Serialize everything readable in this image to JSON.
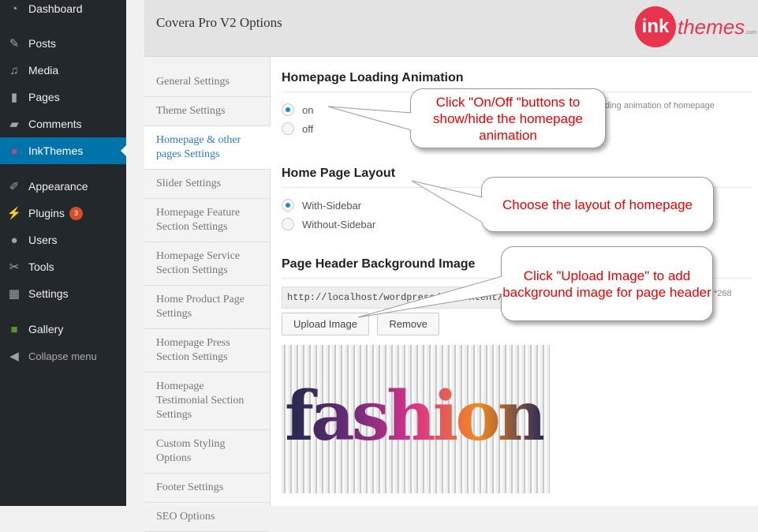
{
  "sidebar": {
    "items": [
      {
        "label": "Dashboard",
        "icon": "dashboard-icon",
        "glyph": "◔"
      },
      {
        "label": "Posts",
        "icon": "pin-icon",
        "glyph": "✎"
      },
      {
        "label": "Media",
        "icon": "media-icon",
        "glyph": "♫"
      },
      {
        "label": "Pages",
        "icon": "pages-icon",
        "glyph": "▮"
      },
      {
        "label": "Comments",
        "icon": "comment-icon",
        "glyph": "▰"
      },
      {
        "label": "InkThemes",
        "icon": "inkthemes-icon",
        "glyph": "●",
        "active": true
      },
      {
        "label": "Appearance",
        "icon": "brush-icon",
        "glyph": "✐"
      },
      {
        "label": "Plugins",
        "icon": "plugin-icon",
        "glyph": "⚡",
        "badge": "3"
      },
      {
        "label": "Users",
        "icon": "user-icon",
        "glyph": "●"
      },
      {
        "label": "Tools",
        "icon": "wrench-icon",
        "glyph": "✂"
      },
      {
        "label": "Settings",
        "icon": "settings-icon",
        "glyph": "▦"
      },
      {
        "label": "Gallery",
        "icon": "gallery-icon",
        "glyph": "■"
      },
      {
        "label": "Collapse menu",
        "icon": "collapse-icon",
        "glyph": "◀"
      }
    ]
  },
  "header": {
    "title": "Covera Pro V2 Options",
    "logo": {
      "mark": "ink",
      "text": "themes",
      "domain": ".com"
    }
  },
  "nav": {
    "items": [
      "General Settings",
      "Theme Settings",
      "Homepage & other pages Settings",
      "Slider Settings",
      "Homepage Feature Section Settings",
      "Homepage Service Section Settings",
      "Home Product Page Settings",
      "Homepage Press Section Settings",
      "Homepage Testimonial Section Settings",
      "Custom Styling Options",
      "Footer Settings",
      "SEO Options"
    ],
    "selected": 2
  },
  "sections": {
    "animation": {
      "title": "Homepage Loading Animation",
      "options": [
        "on",
        "off"
      ],
      "selected": "on",
      "desc": "ding animation of homepage"
    },
    "layout": {
      "title": "Home Page Layout",
      "options": [
        "With-Sidebar",
        "Without-Sidebar"
      ],
      "selected": "With-Sidebar"
    },
    "header_bg": {
      "title": "Page Header Background Image",
      "url": "http://localhost/wordpress/wp-content/uploa",
      "size_note": "*268",
      "upload": "Upload Image",
      "remove": "Remove",
      "image_text": "fashion"
    }
  },
  "callouts": [
    "Click \"On/Off \"buttons to show/hide the homepage animation",
    "Choose the layout of homepage",
    "Click \"Upload Image\" to add background  image for page header"
  ]
}
